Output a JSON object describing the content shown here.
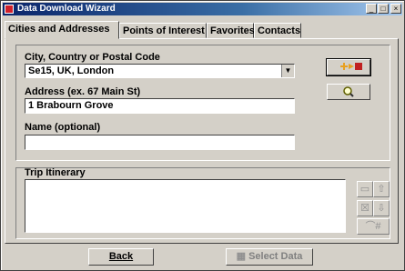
{
  "window": {
    "title": "Data Download Wizard",
    "controls": {
      "minimize": "_",
      "maximize": "□",
      "close": "×"
    }
  },
  "tabs": [
    {
      "label": "Cities and Addresses",
      "active": true
    },
    {
      "label": "Points of Interest",
      "active": false
    },
    {
      "label": "Favorites",
      "active": false
    },
    {
      "label": "Contacts",
      "active": false
    }
  ],
  "location": {
    "city_label": "City, Country or Postal Code",
    "city_value": "Se15, UK, London",
    "address_label": "Address (ex. 67 Main St)",
    "address_value": "1 Brabourn Grove",
    "name_label": "Name (optional)",
    "name_value": "",
    "add_icon": "add-to-itinerary-icon",
    "find_icon": "magnifier-icon"
  },
  "itinerary": {
    "label": "Trip Itinerary",
    "items": [],
    "side_buttons": [
      {
        "name": "notes-button",
        "icon": "note-icon"
      },
      {
        "name": "move-up-button",
        "icon": "arrow-up-icon"
      },
      {
        "name": "delete-button",
        "icon": "x-box-icon"
      },
      {
        "name": "move-down-button",
        "icon": "arrow-down-icon"
      },
      {
        "name": "route-button",
        "icon": "route-icon"
      }
    ]
  },
  "footer": {
    "back_label": "Back",
    "select_label": "Select Data"
  },
  "colors": {
    "face": "#d4d0c8",
    "title_start": "#0a246a",
    "title_end": "#a6caf0",
    "accent_orange": "#e8a020",
    "accent_red": "#c02020"
  }
}
